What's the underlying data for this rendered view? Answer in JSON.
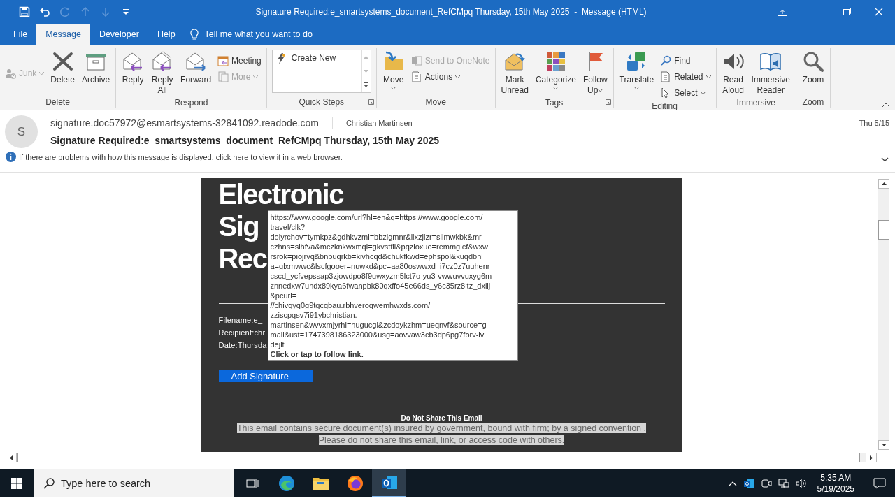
{
  "window": {
    "title": "Signature Required:e_smartsystems_document_RefCMpq Thursday, 15th May 2025  -  Message (HTML)"
  },
  "quick_access": [
    {
      "kind": "save",
      "disabled": false
    },
    {
      "kind": "undo",
      "disabled": false
    },
    {
      "kind": "redo",
      "disabled": true
    },
    {
      "kind": "up",
      "disabled": true
    },
    {
      "kind": "down",
      "disabled": true
    },
    {
      "kind": "customize",
      "disabled": false
    }
  ],
  "tabs": [
    {
      "label": "File",
      "selected": false
    },
    {
      "label": "Message",
      "selected": true
    },
    {
      "label": "Developer",
      "selected": false
    },
    {
      "label": "Help",
      "selected": false
    }
  ],
  "tell_me": "Tell me what you want to do",
  "ribbon": {
    "groups": [
      {
        "label": "Delete",
        "launcher": false,
        "buttons": [
          {
            "kind": "small",
            "label": "Junk",
            "disabled": true,
            "dropdown": true
          },
          {
            "kind": "large",
            "label": "Delete",
            "disabled": false,
            "dropdown": false
          },
          {
            "kind": "large",
            "label": "Archive",
            "disabled": false,
            "dropdown": false
          }
        ]
      },
      {
        "label": "Respond",
        "launcher": false,
        "buttons": [
          {
            "kind": "large",
            "label": "Reply",
            "disabled": false,
            "dropdown": false
          },
          {
            "kind": "large",
            "label": "Reply\nAll",
            "disabled": false,
            "dropdown": false
          },
          {
            "kind": "large",
            "label": "Forward",
            "disabled": false,
            "dropdown": false
          },
          {
            "kind": "small",
            "label": "Meeting",
            "disabled": false,
            "dropdown": false
          },
          {
            "kind": "small",
            "label": "More",
            "disabled": true,
            "dropdown": true
          }
        ]
      },
      {
        "label": "Quick Steps",
        "launcher": true,
        "buttons": [
          {
            "kind": "gallery",
            "label": "Create New",
            "disabled": false,
            "dropdown": false
          }
        ]
      },
      {
        "label": "Move",
        "launcher": false,
        "buttons": [
          {
            "kind": "large",
            "label": "Move",
            "disabled": false,
            "dropdown": true
          },
          {
            "kind": "small",
            "label": "Send to OneNote",
            "disabled": true,
            "dropdown": false
          },
          {
            "kind": "small",
            "label": "Actions",
            "disabled": false,
            "dropdown": true
          }
        ]
      },
      {
        "label": "Tags",
        "launcher": true,
        "buttons": [
          {
            "kind": "large",
            "label": "Mark\nUnread",
            "disabled": false,
            "dropdown": false
          },
          {
            "kind": "large",
            "label": "Categorize",
            "disabled": false,
            "dropdown": true
          },
          {
            "kind": "large",
            "label": "Follow\nUp",
            "disabled": false,
            "dropdown": true
          }
        ]
      },
      {
        "label": "Editing",
        "launcher": false,
        "buttons": [
          {
            "kind": "large",
            "label": "Translate",
            "disabled": false,
            "dropdown": true
          },
          {
            "kind": "small",
            "label": "Find",
            "disabled": false,
            "dropdown": false
          },
          {
            "kind": "small",
            "label": "Related",
            "disabled": false,
            "dropdown": true
          },
          {
            "kind": "small",
            "label": "Select",
            "disabled": false,
            "dropdown": true
          }
        ]
      },
      {
        "label": "Immersive",
        "launcher": false,
        "buttons": [
          {
            "kind": "large",
            "label": "Read\nAloud",
            "disabled": false,
            "dropdown": false
          },
          {
            "kind": "large",
            "label": "Immersive\nReader",
            "disabled": false,
            "dropdown": false
          }
        ]
      },
      {
        "label": "Zoom",
        "launcher": false,
        "buttons": [
          {
            "kind": "large",
            "label": "Zoom",
            "disabled": false,
            "dropdown": false
          }
        ]
      }
    ]
  },
  "message": {
    "avatar": "S",
    "from": "signature.doc57972@esmartsystems-32841092.readode.com",
    "to": "Christian Martinsen",
    "date": "Thu 5/15",
    "subject": "Signature Required:e_smartsystems_document_RefCMpq Thursday, 15th May 2025",
    "infobar": "If there are problems with how this message is displayed, click here to view it in a web browser."
  },
  "email": {
    "heading_lines": [
      "Electronic",
      "Sig",
      "Rec"
    ],
    "details": [
      "Filename:e_",
      "Recipient:chr",
      "Date:Thursda"
    ],
    "button": "Add Signature",
    "notice_title": "Do Not Share This Email",
    "notice_lines": [
      "This email contains secure document(s) insured by government, bound with firm; by a signed convention .",
      "Please do not share this email, link, or access code with others."
    ]
  },
  "tooltip": {
    "lines": [
      "https://www.google.com/url?hl=en&q=https://www.google.com/",
      "travel/clk?",
      "doiyrchov=tymkpz&gdhkvzmi=bbzlgmnr&lixzjizr=siimwkbk&mr",
      "czhns=slhfva&mczknkwxmqi=gkvstfli&pqzloxuo=remmgicf&wxw",
      "rsrok=piojrvq&bnbuqrkb=kivhcqd&chukfkwd=ephspol&kuqdbhl",
      "a=glxmwwc&lscfgooer=nuwkd&pc=aa80oswwxd_i7cz0z7uuhenr",
      "cscd_ycfvepssap3zjowdpo8f9uwxyzm5lct7o-yu3-vwwuvvuxyg6m",
      "znnedxw7undx89kya6fwanpbk80qxffo45e66ds_y6c35rz8ltz_dxilj",
      "&pcurl=",
      "//chivqyq0g9tqcqbau.rbhveroqwemhwxds.com/",
      "zziscpqsv7i91ybchristian.",
      "martinsen&wvvxmjyrhl=nugucgl&zcdoykzhm=ueqnvf&source=g",
      "mail&ust=1747398186323000&usg=aovvaw3cb3dp6pg7forv-iv",
      "dejlt"
    ],
    "action": "Click or tap to follow link."
  },
  "taskbar": {
    "search_placeholder": "Type here to search",
    "apps": [
      {
        "kind": "taskview",
        "active": false
      },
      {
        "kind": "edge",
        "active": false
      },
      {
        "kind": "explorer",
        "active": false
      },
      {
        "kind": "firefox",
        "active": false
      },
      {
        "kind": "outlook",
        "active": true
      }
    ],
    "time": "5:35 AM",
    "date": "5/19/2025"
  }
}
